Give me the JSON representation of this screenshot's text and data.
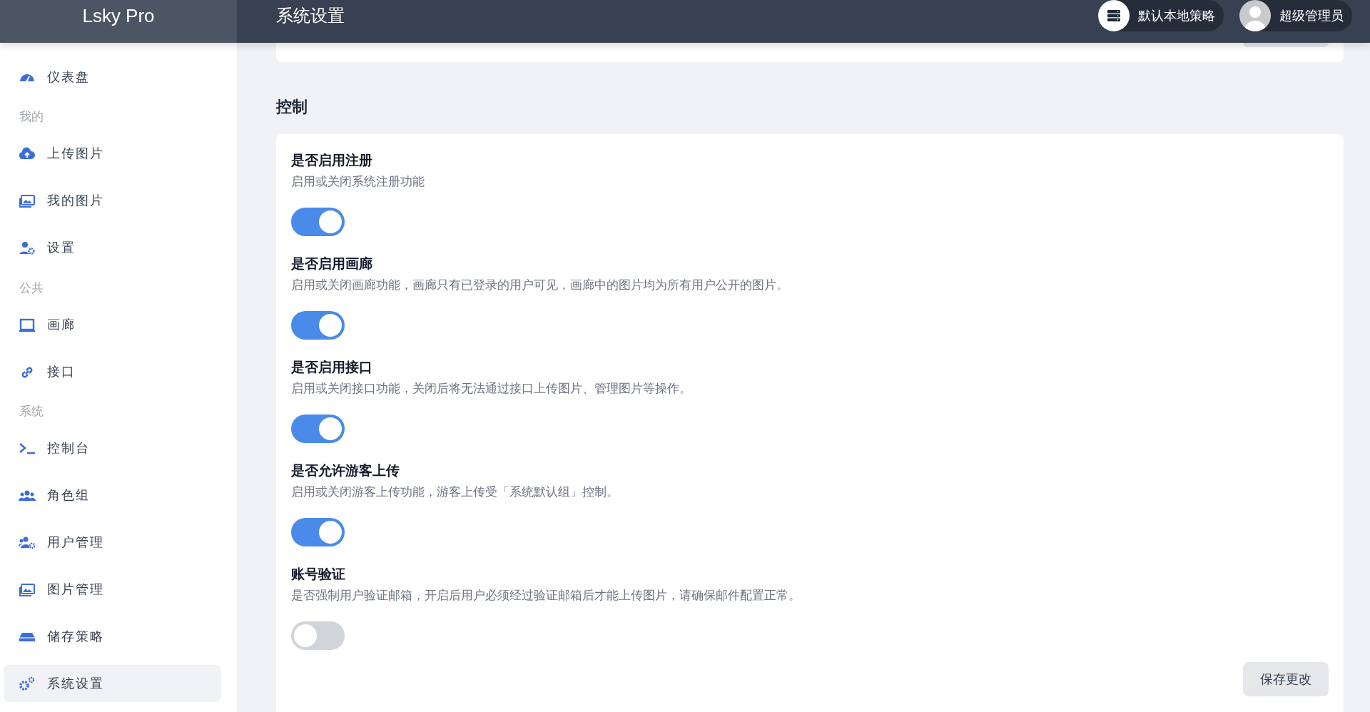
{
  "app": {
    "name": "Lsky Pro"
  },
  "header": {
    "title": "系统设置",
    "policy": "默认本地策略",
    "user": "超级管理员"
  },
  "sidebar": {
    "groups": [
      {
        "items": [
          {
            "label": "仪表盘",
            "selected": false
          }
        ]
      },
      {
        "heading": "我的",
        "items": [
          {
            "label": "上传图片",
            "selected": false
          },
          {
            "label": "我的图片",
            "selected": false
          },
          {
            "label": "设置",
            "selected": false
          }
        ]
      },
      {
        "heading": "公共",
        "items": [
          {
            "label": "画廊",
            "selected": false
          },
          {
            "label": "接口",
            "selected": false
          }
        ]
      },
      {
        "heading": "系统",
        "items": [
          {
            "label": "控制台",
            "selected": false
          },
          {
            "label": "角色组",
            "selected": false
          },
          {
            "label": "用户管理",
            "selected": false
          },
          {
            "label": "图片管理",
            "selected": false
          },
          {
            "label": "储存策略",
            "selected": false
          },
          {
            "label": "系统设置",
            "selected": true
          }
        ]
      }
    ]
  },
  "section": {
    "title": "控制"
  },
  "settings": [
    {
      "title": "是否启用注册",
      "description": "启用或关闭系统注册功能",
      "on": true
    },
    {
      "title": "是否启用画廊",
      "description": "启用或关闭画廊功能，画廊只有已登录的用户可见，画廊中的图片均为所有用户公开的图片。",
      "on": true
    },
    {
      "title": "是否启用接口",
      "description": "启用或关闭接口功能，关闭后将无法通过接口上传图片、管理图片等操作。",
      "on": true
    },
    {
      "title": "是否允许游客上传",
      "description": "启用或关闭游客上传功能，游客上传受「系统默认组」控制。",
      "on": true
    },
    {
      "title": "账号验证",
      "description": "是否强制用户验证邮箱，开启后用户必须经过验证邮箱后才能上传图片，请确保邮件配置正常。",
      "on": false
    }
  ],
  "save_button": "保存更改"
}
